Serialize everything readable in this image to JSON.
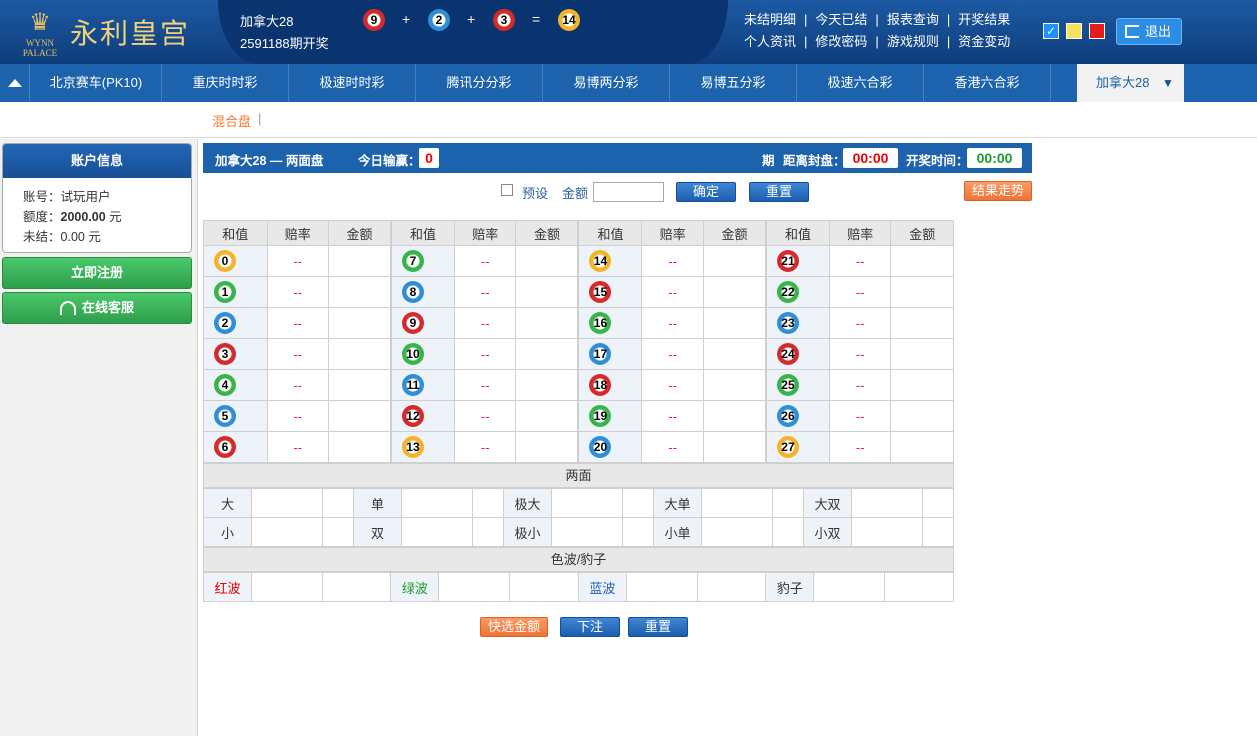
{
  "header": {
    "logo_text": "永利皇宫",
    "logo_sub": "WYNN PALACE",
    "lottery_name": "加拿大28",
    "issue_text": "2591188期开奖",
    "result_balls": [
      "9",
      "2",
      "3"
    ],
    "result_sum": "14",
    "op_plus": "+",
    "op_eq": "=",
    "links_row1": [
      "未结明细",
      "今天已结",
      "报表查询",
      "开奖结果"
    ],
    "links_row2": [
      "个人资讯",
      "修改密码",
      "游戏规则",
      "资金变动"
    ],
    "link_sep": "|",
    "logout_label": "退出",
    "theme_colors": [
      "#1e90ff",
      "#f5e35a",
      "#e61b1b"
    ]
  },
  "nav": {
    "items": [
      "北京赛车(PK10)",
      "重庆时时彩",
      "极速时时彩",
      "腾讯分分彩",
      "易博两分彩",
      "易博五分彩",
      "极速六合彩",
      "香港六合彩"
    ],
    "active": "加拿大28",
    "active_arrow": "▼"
  },
  "subnav": {
    "item": "混合盘",
    "sep": "|"
  },
  "account": {
    "title": "账户信息",
    "user_label": "账号：",
    "user_value": "试玩用户",
    "limit_label": "额度：",
    "limit_value": "2000.00",
    "limit_unit": " 元",
    "pending_label": "未结：",
    "pending_value": "0.00 元",
    "register_label": "立即注册",
    "service_label": "在线客服"
  },
  "infobar": {
    "title": "加拿大28 — 两面盘",
    "today_label": "今日输赢：",
    "today_value": "0",
    "period_label": "期",
    "close_label": "距离封盘：",
    "close_value": "00:00",
    "open_label": "开奖时间：",
    "open_value": "00:00"
  },
  "controls": {
    "preset_label": "预设",
    "amount_label": "金额",
    "confirm_label": "确定",
    "reset_label": "重置",
    "trend_label": "结果走势"
  },
  "grid": {
    "headers": [
      "和值",
      "赔率",
      "金额"
    ],
    "odds_placeholder": "--",
    "columns": [
      [
        {
          "n": "0",
          "c": "y"
        },
        {
          "n": "1",
          "c": "g"
        },
        {
          "n": "2",
          "c": "b"
        },
        {
          "n": "3",
          "c": "r"
        },
        {
          "n": "4",
          "c": "g"
        },
        {
          "n": "5",
          "c": "b"
        },
        {
          "n": "6",
          "c": "r"
        }
      ],
      [
        {
          "n": "7",
          "c": "g"
        },
        {
          "n": "8",
          "c": "b"
        },
        {
          "n": "9",
          "c": "r"
        },
        {
          "n": "10",
          "c": "g"
        },
        {
          "n": "11",
          "c": "b"
        },
        {
          "n": "12",
          "c": "r"
        },
        {
          "n": "13",
          "c": "y"
        }
      ],
      [
        {
          "n": "14",
          "c": "y"
        },
        {
          "n": "15",
          "c": "r"
        },
        {
          "n": "16",
          "c": "g"
        },
        {
          "n": "17",
          "c": "b"
        },
        {
          "n": "18",
          "c": "r"
        },
        {
          "n": "19",
          "c": "g"
        },
        {
          "n": "20",
          "c": "b"
        }
      ],
      [
        {
          "n": "21",
          "c": "r"
        },
        {
          "n": "22",
          "c": "g"
        },
        {
          "n": "23",
          "c": "b"
        },
        {
          "n": "24",
          "c": "r"
        },
        {
          "n": "25",
          "c": "g"
        },
        {
          "n": "26",
          "c": "b"
        },
        {
          "n": "27",
          "c": "y"
        }
      ]
    ]
  },
  "two_sides": {
    "title": "两面",
    "row1": [
      "大",
      "单",
      "极大",
      "大单",
      "大双"
    ],
    "row2": [
      "小",
      "双",
      "极小",
      "小单",
      "小双"
    ]
  },
  "waves": {
    "title": "色波/豹子",
    "items": [
      {
        "label": "红波",
        "cls": "c-red"
      },
      {
        "label": "绿波",
        "cls": "c-green"
      },
      {
        "label": "蓝波",
        "cls": "c-blue"
      },
      {
        "label": "豹子",
        "cls": ""
      }
    ]
  },
  "footer": {
    "quick_label": "快选金额",
    "submit_label": "下注",
    "reset_label": "重置"
  }
}
